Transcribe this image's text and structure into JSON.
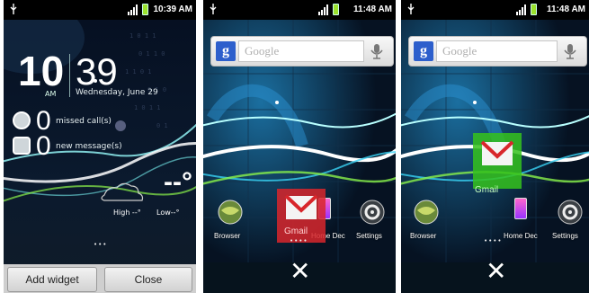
{
  "colors": {
    "statusbar_bg": "#000000",
    "battery": "#9be22d",
    "gmail_red": "#d8262b",
    "gmail_green": "#35c21c",
    "google_blue": "#2d5fcc",
    "wave_cyan": "#39d3f5",
    "wave_green": "#8af24a"
  },
  "screens": [
    {
      "status": {
        "time": "10:39 AM",
        "icons": [
          "usb-icon",
          "signal-icon",
          "battery-icon"
        ]
      },
      "lock": {
        "hour": "10",
        "ampm": "AM",
        "minute": "39",
        "date": "Wednesday, June 29",
        "missed_calls": {
          "count": "0",
          "label": "missed call(s)"
        },
        "new_messages": {
          "count": "0",
          "label": "new message(s)"
        },
        "weather": {
          "temp": "--°",
          "high": "High --°",
          "low": "Low--°"
        },
        "page_dots": "•••"
      },
      "buttons": {
        "add_widget": "Add widget",
        "close": "Close"
      }
    },
    {
      "status": {
        "time": "11:48 AM"
      },
      "search": {
        "logo": "g",
        "placeholder": "Google",
        "icons": [
          "google-g-icon",
          "mic-icon"
        ]
      },
      "dock": {
        "browser": "Browser",
        "home_deco": "Home Dec",
        "settings": "Settings"
      },
      "dragging": {
        "widget": "Gmail",
        "state": "over-trash"
      },
      "page_dots": "••••",
      "trash_symbol": "✕"
    },
    {
      "status": {
        "time": "11:48 AM"
      },
      "search": {
        "logo": "g",
        "placeholder": "Google"
      },
      "dock": {
        "browser": "Browser",
        "home_deco": "Home Dec",
        "settings": "Settings"
      },
      "dragging": {
        "widget": "Gmail",
        "state": "valid-drop"
      },
      "page_dots": "••••",
      "trash_symbol": "✕"
    }
  ]
}
